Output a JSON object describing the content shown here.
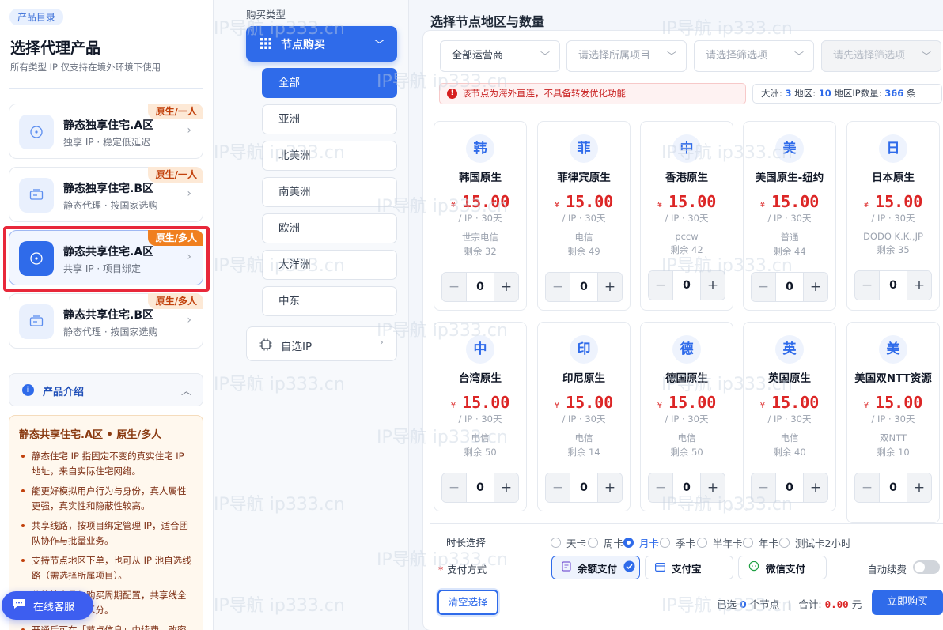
{
  "left": {
    "category_badge": "产品目录",
    "title": "选择代理产品",
    "subtitle": "所有类型 IP 仅支持在境外环境下使用",
    "products": [
      {
        "name": "静态独享住宅.A区",
        "desc": "独享 IP · 稳定低延迟",
        "tag": "原生/一人",
        "icon": "target-icon"
      },
      {
        "name": "静态独享住宅.B区",
        "desc": "静态代理 · 按国家选购",
        "tag": "原生/一人",
        "icon": "ticket-icon"
      },
      {
        "name": "静态共享住宅.A区",
        "desc": "共享 IP · 项目绑定",
        "tag": "原生/多人",
        "icon": "target-icon"
      },
      {
        "name": "静态共享住宅.B区",
        "desc": "静态代理 · 按国家选购",
        "tag": "原生/多人",
        "icon": "ticket-icon"
      }
    ],
    "intro_title": "产品介绍",
    "intro_heading": "静态共享住宅.A区 • 原生/多人",
    "intro_items": [
      "静态住宅 IP 指固定不变的真实住宅 IP 地址，来自实际住宅网络。",
      "能更好模拟用户行为与身份，真人属性更强，真实性和隐蔽性较高。",
      "共享线路，按项目绑定管理 IP，适合团队协作与批量业务。",
      "支持节点地区下单，也可从 IP 池自选线路（需选择所属项目）。",
      "价格按产品与购买周期配置，共享线全部按节点地区拆分。",
      "开通后可在「节点信息」中续费、改密"
    ],
    "service": "在线客服"
  },
  "mid": {
    "label": "购买类型",
    "node_buy": "节点购买",
    "regions": [
      "全部",
      "亚洲",
      "北美洲",
      "南美洲",
      "欧洲",
      "大洋洲",
      "中东"
    ],
    "custom": "自选IP"
  },
  "right": {
    "title": "选择节点地区与数量",
    "filters": [
      "全部运营商",
      "请选择所属项目",
      "请选择筛选项",
      "请先选择筛选项"
    ],
    "warning": "该节点为海外直连，不具备转发优化功能",
    "stats": {
      "continent_label": "大洲:",
      "continent": "3",
      "region_label": "地区:",
      "region": "10",
      "ipcount_label": "地区IP数量:",
      "ipcount": "366",
      "unit": "条"
    },
    "currency": "¥",
    "unit": "/ IP · 30天",
    "cards": [
      {
        "flag": "韩",
        "name": "韩国原生",
        "price": "15.00",
        "isp": "世宗电信",
        "remain": "剩余 32",
        "qty": "0"
      },
      {
        "flag": "菲",
        "name": "菲律宾原生",
        "price": "15.00",
        "isp": "电信",
        "remain": "剩余 49",
        "qty": "0"
      },
      {
        "flag": "中",
        "name": "香港原生",
        "price": "15.00",
        "isp": "pccw",
        "remain": "剩余 42",
        "qty": "0"
      },
      {
        "flag": "美",
        "name": "美国原生-纽约",
        "price": "15.00",
        "isp": "普通",
        "remain": "剩余 44",
        "qty": "0"
      },
      {
        "flag": "日",
        "name": "日本原生",
        "price": "15.00",
        "isp": "DODO K.K.,JP",
        "remain": "剩余 35",
        "qty": "0"
      },
      {
        "flag": "中",
        "name": "台湾原生",
        "price": "15.00",
        "isp": "电信",
        "remain": "剩余 50",
        "qty": "0"
      },
      {
        "flag": "印",
        "name": "印尼原生",
        "price": "15.00",
        "isp": "电信",
        "remain": "剩余 14",
        "qty": "0"
      },
      {
        "flag": "德",
        "name": "德国原生",
        "price": "15.00",
        "isp": "电信",
        "remain": "剩余 50",
        "qty": "0"
      },
      {
        "flag": "英",
        "name": "英国原生",
        "price": "15.00",
        "isp": "电信",
        "remain": "剩余 40",
        "qty": "0"
      },
      {
        "flag": "美",
        "name": "美国双NTT资源",
        "price": "15.00",
        "isp": "双NTT",
        "remain": "剩余 10",
        "qty": "0"
      }
    ],
    "duration_label": "时长选择",
    "durations": [
      "天卡",
      "周卡",
      "月卡",
      "季卡",
      "半年卡",
      "年卡",
      "测试卡2小时"
    ],
    "duration_selected": "月卡",
    "payment_label": "支付方式",
    "payments": [
      "余额支付",
      "支付宝",
      "微信支付"
    ],
    "payment_selected": "余额支付",
    "auto_renew": "自动续费",
    "clear": "清空选择",
    "summary": {
      "pre": "已选",
      "count": "0",
      "post": "个节点",
      "total_label": "合计:",
      "total": "0.00",
      "yuan": "元"
    },
    "buy": "立即购买"
  },
  "watermark": "IP导航  ip333.cn"
}
